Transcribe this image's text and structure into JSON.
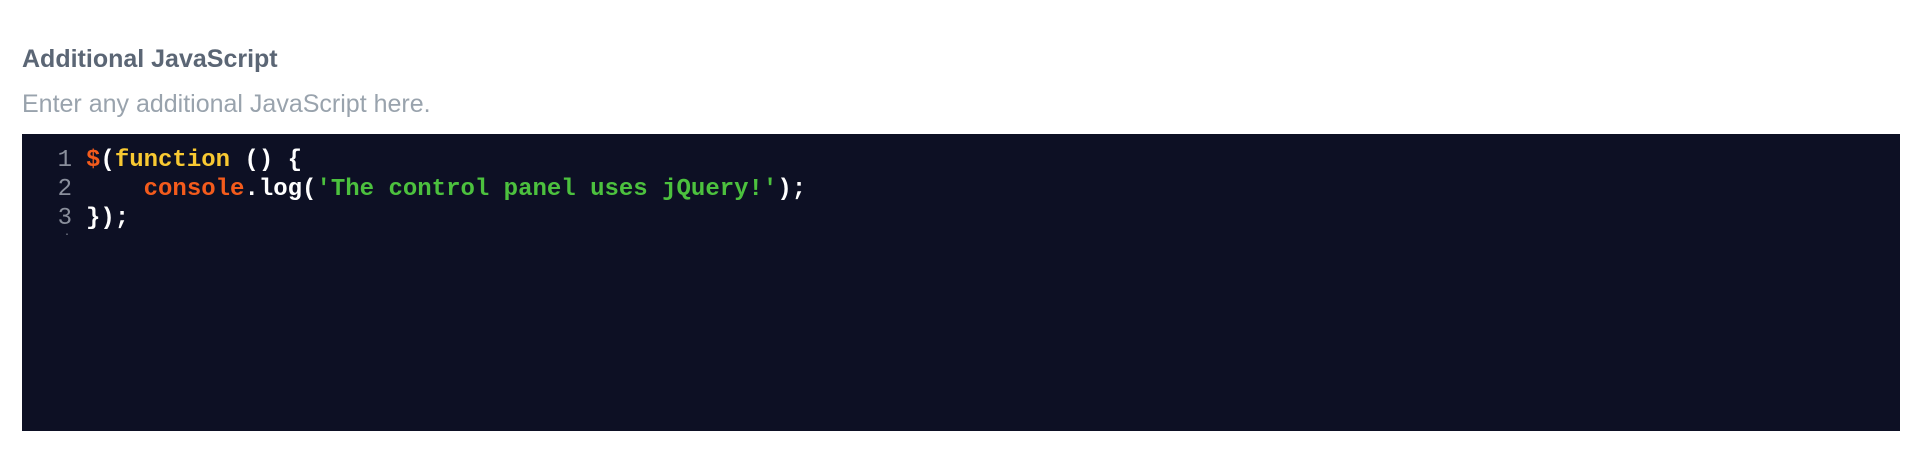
{
  "field": {
    "title": "Additional JavaScript",
    "hint": "Enter any additional JavaScript here."
  },
  "editor": {
    "background_color": "#0d1024",
    "token_colors": {
      "dollar": "#f35b1c",
      "keyword": "#f8c932",
      "console": "#f35b1c",
      "string": "#4cc13e",
      "plain": "#ffffff"
    },
    "line_numbers": [
      "1",
      "2",
      "3"
    ],
    "lines": [
      {
        "t1": "$",
        "t2": "(",
        "t3": "function",
        "t4": " () {"
      },
      {
        "t1": "    ",
        "t2": "console",
        "t3": ".log(",
        "t4": "'The control panel uses jQuery!'",
        "t5": ");"
      },
      {
        "t1": "});"
      }
    ]
  }
}
